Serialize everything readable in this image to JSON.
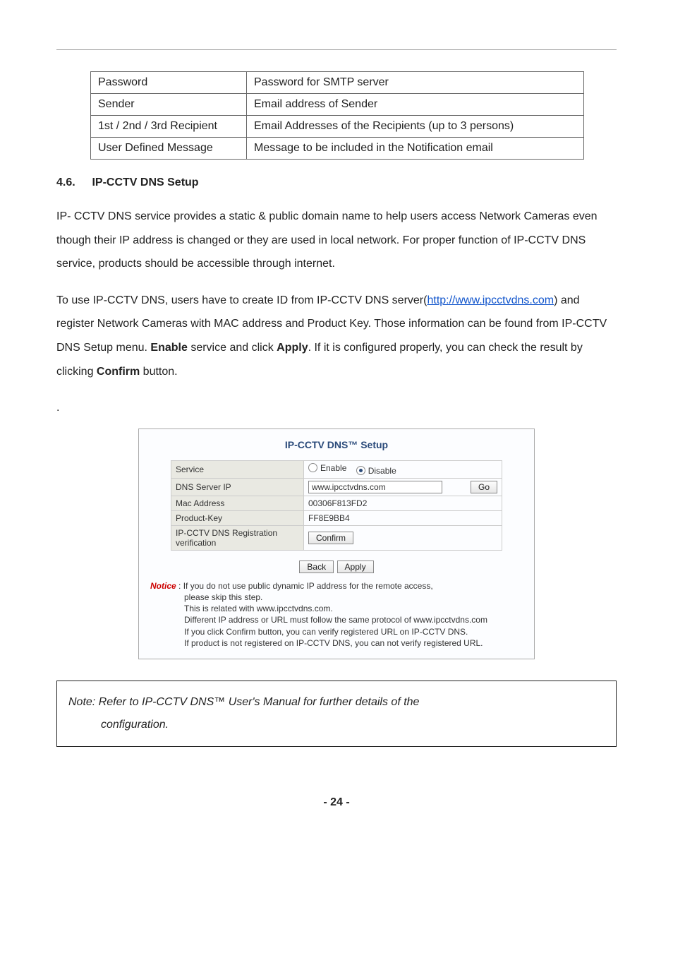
{
  "fields_table": [
    {
      "key": "Password",
      "val": "Password for SMTP server"
    },
    {
      "key": "Sender",
      "val": "Email address of Sender"
    },
    {
      "key": "1st / 2nd / 3rd Recipient",
      "val": "Email Addresses of the Recipients (up to 3 persons)"
    },
    {
      "key": "User Defined Message",
      "val": "Message to be included in the Notification email"
    }
  ],
  "section": {
    "number": "4.6.",
    "title": "IP-CCTV DNS Setup"
  },
  "para1": "IP- CCTV DNS service provides a static & public domain name to help users access Network Cameras even though their IP address is changed or they are used in local network. For proper function of IP-CCTV DNS service, products should be accessible through internet.",
  "para2_pre": "To use IP-CCTV DNS, users have to create ID from IP-CCTV DNS server(",
  "para2_link": "http://www.ipcctvdns.com",
  "para2_post1": ") and register Network Cameras with MAC address and Product Key. Those information can be found from IP-CCTV DNS Setup menu. ",
  "para2_strong1": "Enable",
  "para2_mid": " service and click ",
  "para2_strong2": "Apply",
  "para2_post2": ". If it is configured properly, you can check the result by clicking ",
  "para2_strong3": "Confirm",
  "para2_post3": " button.",
  "dot": ".",
  "setup": {
    "title": "IP-CCTV DNS™ Setup",
    "rows": {
      "service_label": "Service",
      "enable": "Enable",
      "disable": "Disable",
      "dns_label": "DNS Server IP",
      "dns_value": "www.ipcctvdns.com",
      "go": "Go",
      "mac_label": "Mac Address",
      "mac_value": "00306F813FD2",
      "pk_label": "Product-Key",
      "pk_value": "FF8E9BB4",
      "reg_label": "IP-CCTV DNS Registration verification",
      "confirm": "Confirm"
    },
    "back": "Back",
    "apply": "Apply",
    "notice_label": "Notice",
    "notice_colon": " : ",
    "notice_line1": "If you do not use public dynamic IP address for the remote access,",
    "notice_line2": "please skip this step.",
    "notice_line3": "This is related with www.ipcctvdns.com.",
    "notice_line4": "Different IP address or URL must follow the same protocol of www.ipcctvdns.com",
    "notice_line5": "If you click Confirm button, you can verify registered URL on IP-CCTV DNS.",
    "notice_line6": "If product is not registered on IP-CCTV DNS, you can not verify registered URL."
  },
  "note_box_line1": "Note: Refer to IP-CCTV DNS™ User's Manual for further details of the",
  "note_box_line2": "configuration.",
  "page_number": "- 24 -"
}
